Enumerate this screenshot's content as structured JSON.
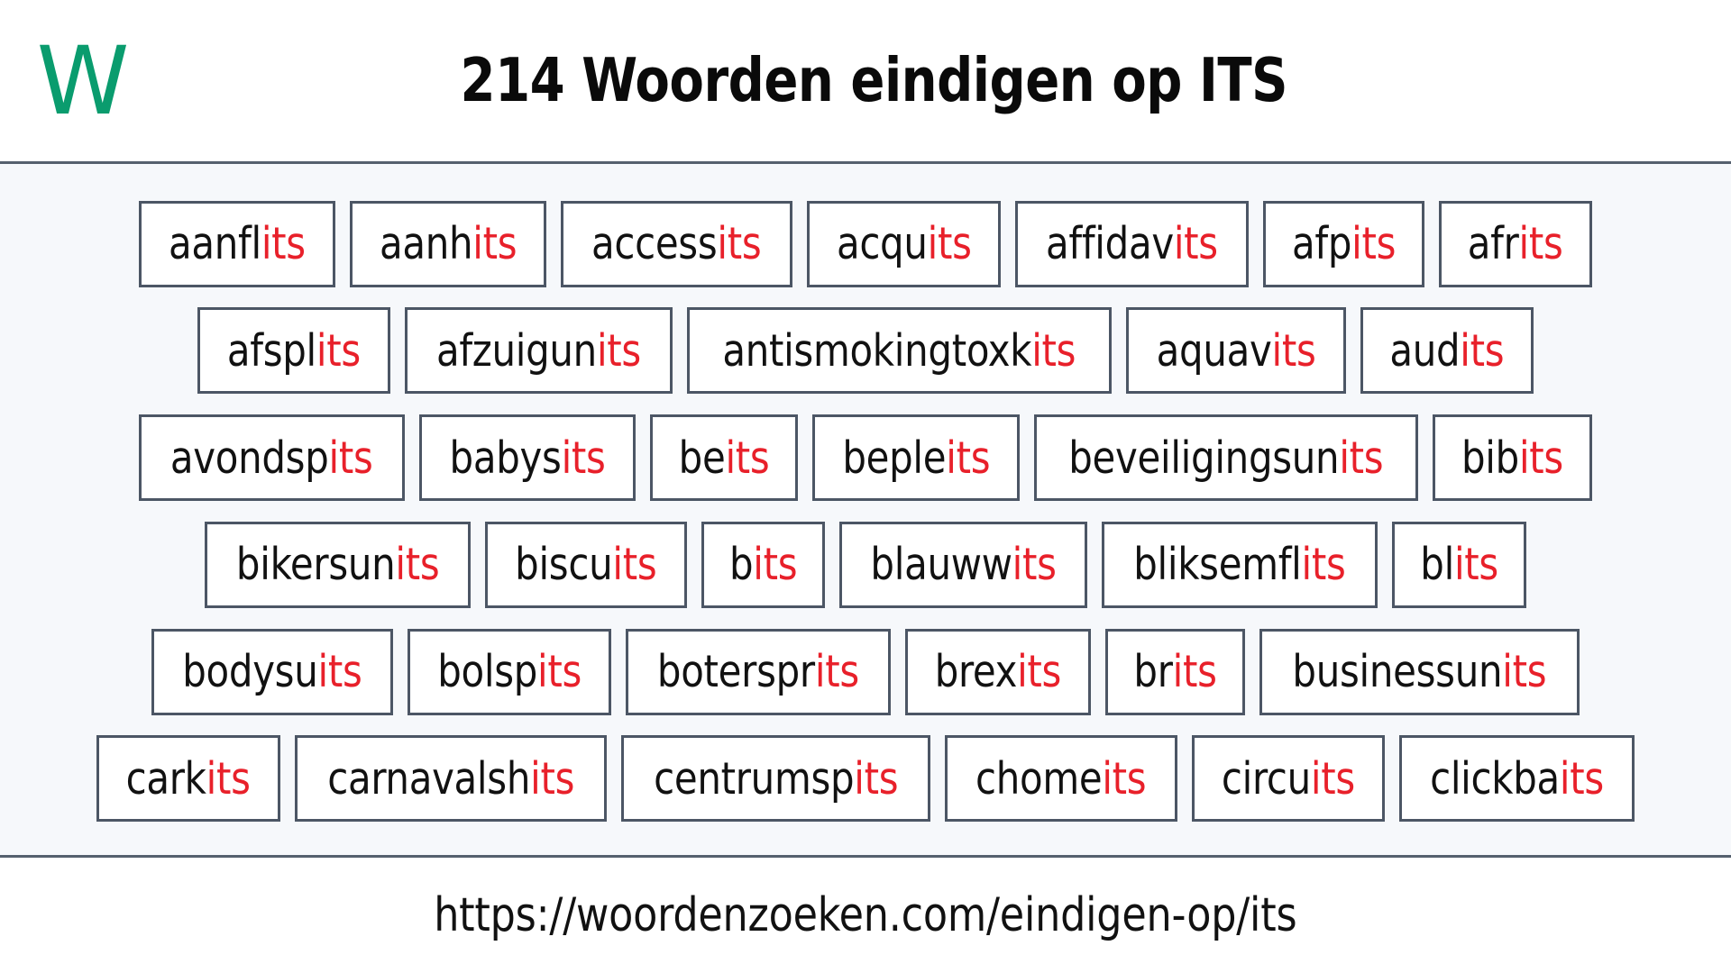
{
  "header": {
    "logo": {
      "letter": "W",
      "color": "#0a9c6e",
      "icon_name": "woordenzoeken-logo"
    },
    "title": "214 Woorden eindigen op ITS"
  },
  "colors": {
    "suffix_red": "#e8202a",
    "logo_green": "#0a9c6e",
    "chip_border": "#4c5665",
    "page_background": "#f6f8fb",
    "band_background": "#ffffff",
    "text_black": "#111111"
  },
  "word_list": {
    "suffix": "its",
    "count": 214,
    "rows": [
      [
        {
          "stem": "aanfl",
          "suffix": "its"
        },
        {
          "stem": "aanh",
          "suffix": "its"
        },
        {
          "stem": "access",
          "suffix": "its"
        },
        {
          "stem": "acqu",
          "suffix": "its"
        },
        {
          "stem": "affidav",
          "suffix": "its"
        },
        {
          "stem": "afp",
          "suffix": "its"
        },
        {
          "stem": "afr",
          "suffix": "its"
        }
      ],
      [
        {
          "stem": "afspl",
          "suffix": "its"
        },
        {
          "stem": "afzuigun",
          "suffix": "its"
        },
        {
          "stem": "antismokingtoxk",
          "suffix": "its"
        },
        {
          "stem": "aquav",
          "suffix": "its"
        },
        {
          "stem": "aud",
          "suffix": "its"
        }
      ],
      [
        {
          "stem": "avondsp",
          "suffix": "its"
        },
        {
          "stem": "babys",
          "suffix": "its"
        },
        {
          "stem": "be",
          "suffix": "its"
        },
        {
          "stem": "beple",
          "suffix": "its"
        },
        {
          "stem": "beveiligingsun",
          "suffix": "its"
        },
        {
          "stem": "bib",
          "suffix": "its"
        }
      ],
      [
        {
          "stem": "bikersun",
          "suffix": "its"
        },
        {
          "stem": "biscu",
          "suffix": "its"
        },
        {
          "stem": "b",
          "suffix": "its"
        },
        {
          "stem": "blauww",
          "suffix": "its"
        },
        {
          "stem": "bliksemfl",
          "suffix": "its"
        },
        {
          "stem": "bl",
          "suffix": "its"
        }
      ],
      [
        {
          "stem": "bodysu",
          "suffix": "its"
        },
        {
          "stem": "bolsp",
          "suffix": "its"
        },
        {
          "stem": "boterspr",
          "suffix": "its"
        },
        {
          "stem": "brex",
          "suffix": "its"
        },
        {
          "stem": "br",
          "suffix": "its"
        },
        {
          "stem": "businessun",
          "suffix": "its"
        }
      ],
      [
        {
          "stem": "cark",
          "suffix": "its"
        },
        {
          "stem": "carnavalsh",
          "suffix": "its"
        },
        {
          "stem": "centrumsp",
          "suffix": "its"
        },
        {
          "stem": "chome",
          "suffix": "its"
        },
        {
          "stem": "circu",
          "suffix": "its"
        },
        {
          "stem": "clickba",
          "suffix": "its"
        }
      ]
    ]
  },
  "footer": {
    "url": "https://woordenzoeken.com/eindigen-op/its"
  }
}
